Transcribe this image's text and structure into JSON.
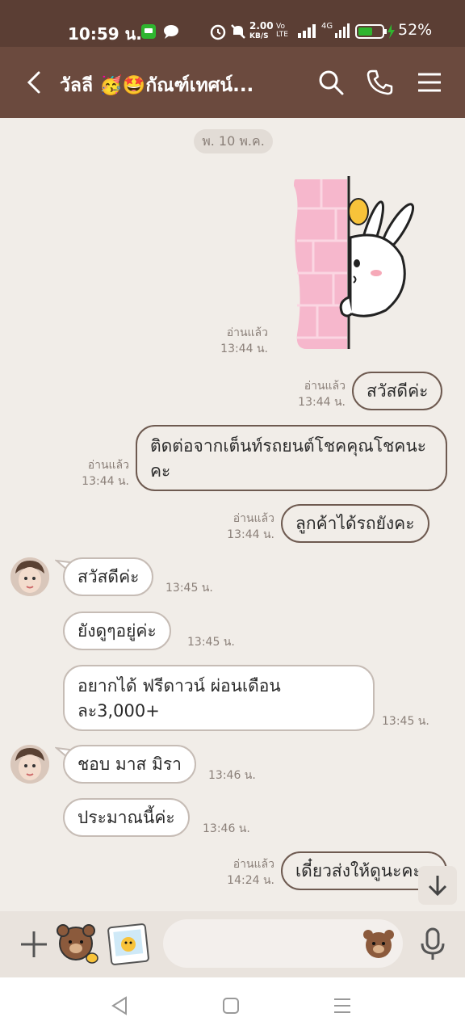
{
  "status_bar": {
    "time": "10:59 น.",
    "net_speed": "2.00",
    "net_unit": "KB/S",
    "volte": "Vo LTE",
    "network": "4G",
    "battery_percent": "52%"
  },
  "header": {
    "title": "วัลลี 🥳🤩กัณฑ์เทศน์..."
  },
  "chat": {
    "date_chip": "พ. 10 พ.ค.",
    "sticker": {
      "read_label": "อ่านแล้ว",
      "time": "13:44 น."
    },
    "outgoing": [
      {
        "read": "อ่านแล้ว",
        "time": "13:44 น.",
        "text": "สวัสดีค่ะ"
      },
      {
        "read": "อ่านแล้ว",
        "time": "13:44 น.",
        "text": "ติดต่อจากเต็นท์รถยนต์โชคคุณโชคนะคะ"
      },
      {
        "read": "อ่านแล้ว",
        "time": "13:44 น.",
        "text": "ลูกค้าได้รถยังคะ"
      },
      {
        "read": "อ่านแล้ว",
        "time": "14:24 น.",
        "text": "เดี๋ยวส่งให้ดูนะคะ"
      }
    ],
    "incoming": [
      {
        "text": "สวัสดีค่ะ",
        "time": "13:45 น."
      },
      {
        "text": "ยังดูๆอยู่ค่ะ",
        "time": "13:45 น."
      },
      {
        "text": "อยากได้ ฟรีดาวน์ ผ่อนเดือนละ3,000+",
        "time": "13:45 น."
      },
      {
        "text": "ชอบ มาส มิรา",
        "time": "13:46 น."
      },
      {
        "text": "ประมาณนี้ค่ะ",
        "time": "13:46 น."
      }
    ]
  },
  "composer": {
    "input_value": ""
  },
  "colors": {
    "status_bar": "#5b3e34",
    "header": "#6b4a3e",
    "chat_bg": "#f1ede8",
    "bubble_border": "#6e5a50",
    "accent_green": "#2fb52f"
  }
}
